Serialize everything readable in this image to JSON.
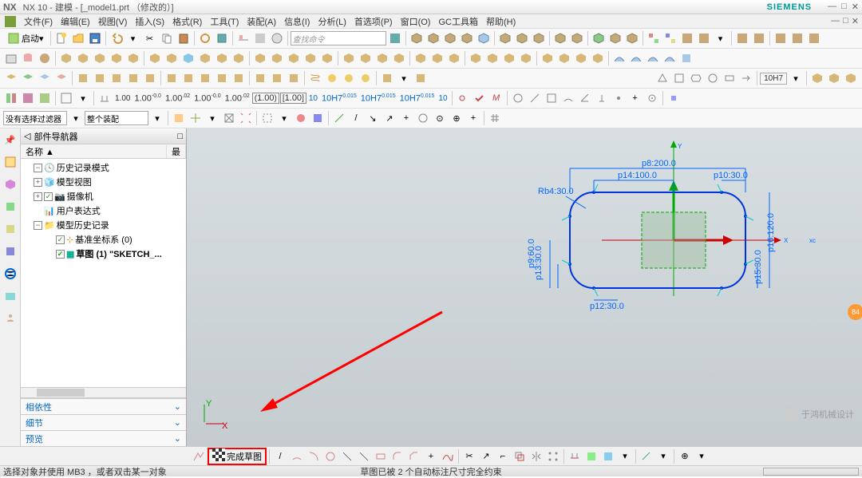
{
  "title": {
    "app": "NX",
    "ver": "NX 10 - 建模 - [_model1.prt （修改的）]",
    "brand": "SIEMENS"
  },
  "menu": [
    "文件(F)",
    "编辑(E)",
    "视图(V)",
    "插入(S)",
    "格式(R)",
    "工具(T)",
    "装配(A)",
    "信息(I)",
    "分析(L)",
    "首选项(P)",
    "窗口(O)",
    "GC工具箱",
    "帮助(H)"
  ],
  "tb1": {
    "start": "启动",
    "search": "查找命令"
  },
  "tb_filter": {
    "nofilter": "没有选择过滤器",
    "assy": "整个装配"
  },
  "tb_dim": [
    "1.00",
    "1.00",
    "1.00",
    "1.00",
    "1.00",
    "1.00",
    "1.00",
    "10",
    "10H7",
    "10H7",
    "10H7",
    "10"
  ],
  "tb_dim_sub": [
    "",
    "-0.0",
    ".02",
    "-0.0",
    ".02",
    "",
    "",
    "",
    "0.015",
    "0.015",
    "0.015",
    ""
  ],
  "tb_fit": "10H7",
  "nav": {
    "title": "部件导航器",
    "col1": "名称 ▲",
    "col2": "最",
    "items": [
      {
        "ic": "clock",
        "label": "历史记录模式"
      },
      {
        "ic": "mview",
        "label": "模型视图",
        "chk": true
      },
      {
        "ic": "cam",
        "label": "摄像机",
        "chk": true
      },
      {
        "ic": "expr",
        "label": "用户表达式"
      },
      {
        "ic": "folder",
        "label": "模型历史记录",
        "exp": true
      },
      {
        "ic": "csys",
        "label": "基准坐标系 (0)",
        "chk": true,
        "indent": 3
      },
      {
        "ic": "sketch",
        "label": "草图 (1) \"SKETCH_...",
        "chk": true,
        "indent": 3,
        "bold": true
      }
    ],
    "sections": [
      "相依性",
      "细节",
      "预览"
    ]
  },
  "sketch": {
    "dims": {
      "p8": "p8:200.0",
      "p14": "p14:100.0",
      "p10": "p10:30.0",
      "rb4": "Rb4:30.0",
      "p12": "p12:30.0",
      "p13": "p13:30.0",
      "p9": "p9:60.0",
      "p15": "p15:30.0",
      "p16": "p16:120.0"
    },
    "axes": {
      "x": "X",
      "y": "Y",
      "xc": "xc"
    }
  },
  "chart_data": {
    "type": "table",
    "title": "Sketch dimensions",
    "series": [
      {
        "name": "p8",
        "values": [
          200.0
        ]
      },
      {
        "name": "p14",
        "values": [
          100.0
        ]
      },
      {
        "name": "p10",
        "values": [
          30.0
        ]
      },
      {
        "name": "Rb4",
        "values": [
          30.0
        ]
      },
      {
        "name": "p12",
        "values": [
          30.0
        ]
      },
      {
        "name": "p13",
        "values": [
          30.0
        ]
      },
      {
        "name": "p9",
        "values": [
          60.0
        ]
      },
      {
        "name": "p15",
        "values": [
          30.0
        ]
      },
      {
        "name": "p16",
        "values": [
          120.0
        ]
      }
    ]
  },
  "bottom": {
    "finish": "完成草图"
  },
  "status": {
    "left": "选择对象并使用 MB3 ，或者双击某一对象",
    "mid": "草图已被 2 个自动标注尺寸完全约束"
  },
  "watermark": "于鸿机械设计",
  "badge": "84"
}
